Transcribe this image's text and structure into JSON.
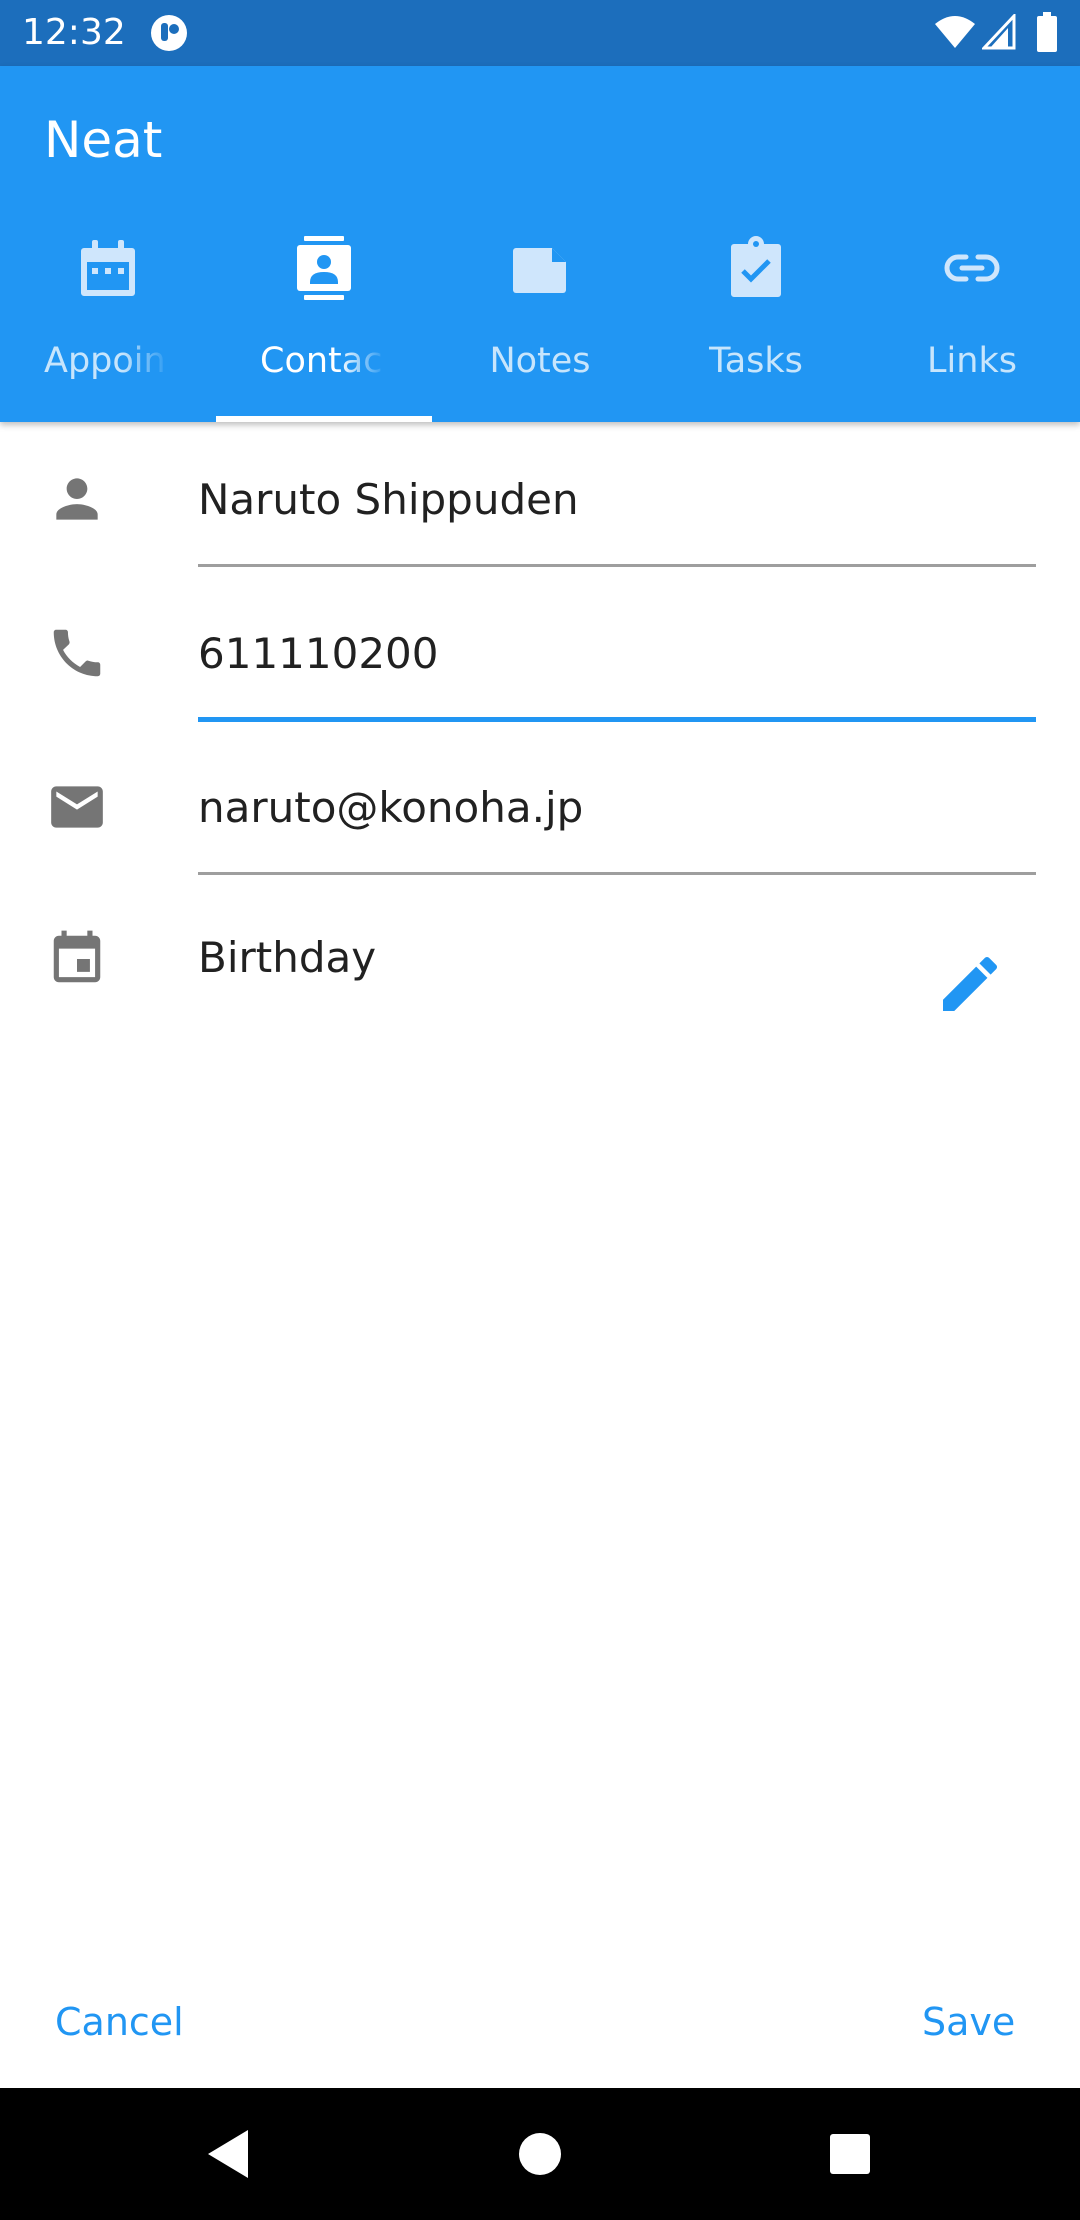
{
  "status_bar": {
    "time": "12:32",
    "color": "#1c6ebc"
  },
  "app_bar": {
    "title": "Neat",
    "color": "#2196f3"
  },
  "tabs": [
    {
      "label": "Appoin",
      "icon": "calendar-icon",
      "active": false
    },
    {
      "label": "Contac",
      "icon": "contact-card-icon",
      "active": true
    },
    {
      "label": "Notes",
      "icon": "note-icon",
      "active": false
    },
    {
      "label": "Tasks",
      "icon": "clipboard-check-icon",
      "active": false
    },
    {
      "label": "Links",
      "icon": "link-icon",
      "active": false
    }
  ],
  "contact_form": {
    "name": {
      "value": "Naruto Shippuden",
      "icon": "person-icon"
    },
    "phone": {
      "value": "611110200",
      "icon": "phone-icon",
      "focused": true
    },
    "email": {
      "value": "naruto@konoha.jp",
      "icon": "email-icon"
    },
    "birthday": {
      "label": "Birthday",
      "icon": "calendar-icon",
      "edit_icon": "pencil-icon"
    }
  },
  "actions": {
    "cancel_label": "Cancel",
    "save_label": "Save"
  },
  "nav_bar": {
    "buttons": [
      "back-icon",
      "home-icon",
      "recents-icon"
    ]
  }
}
